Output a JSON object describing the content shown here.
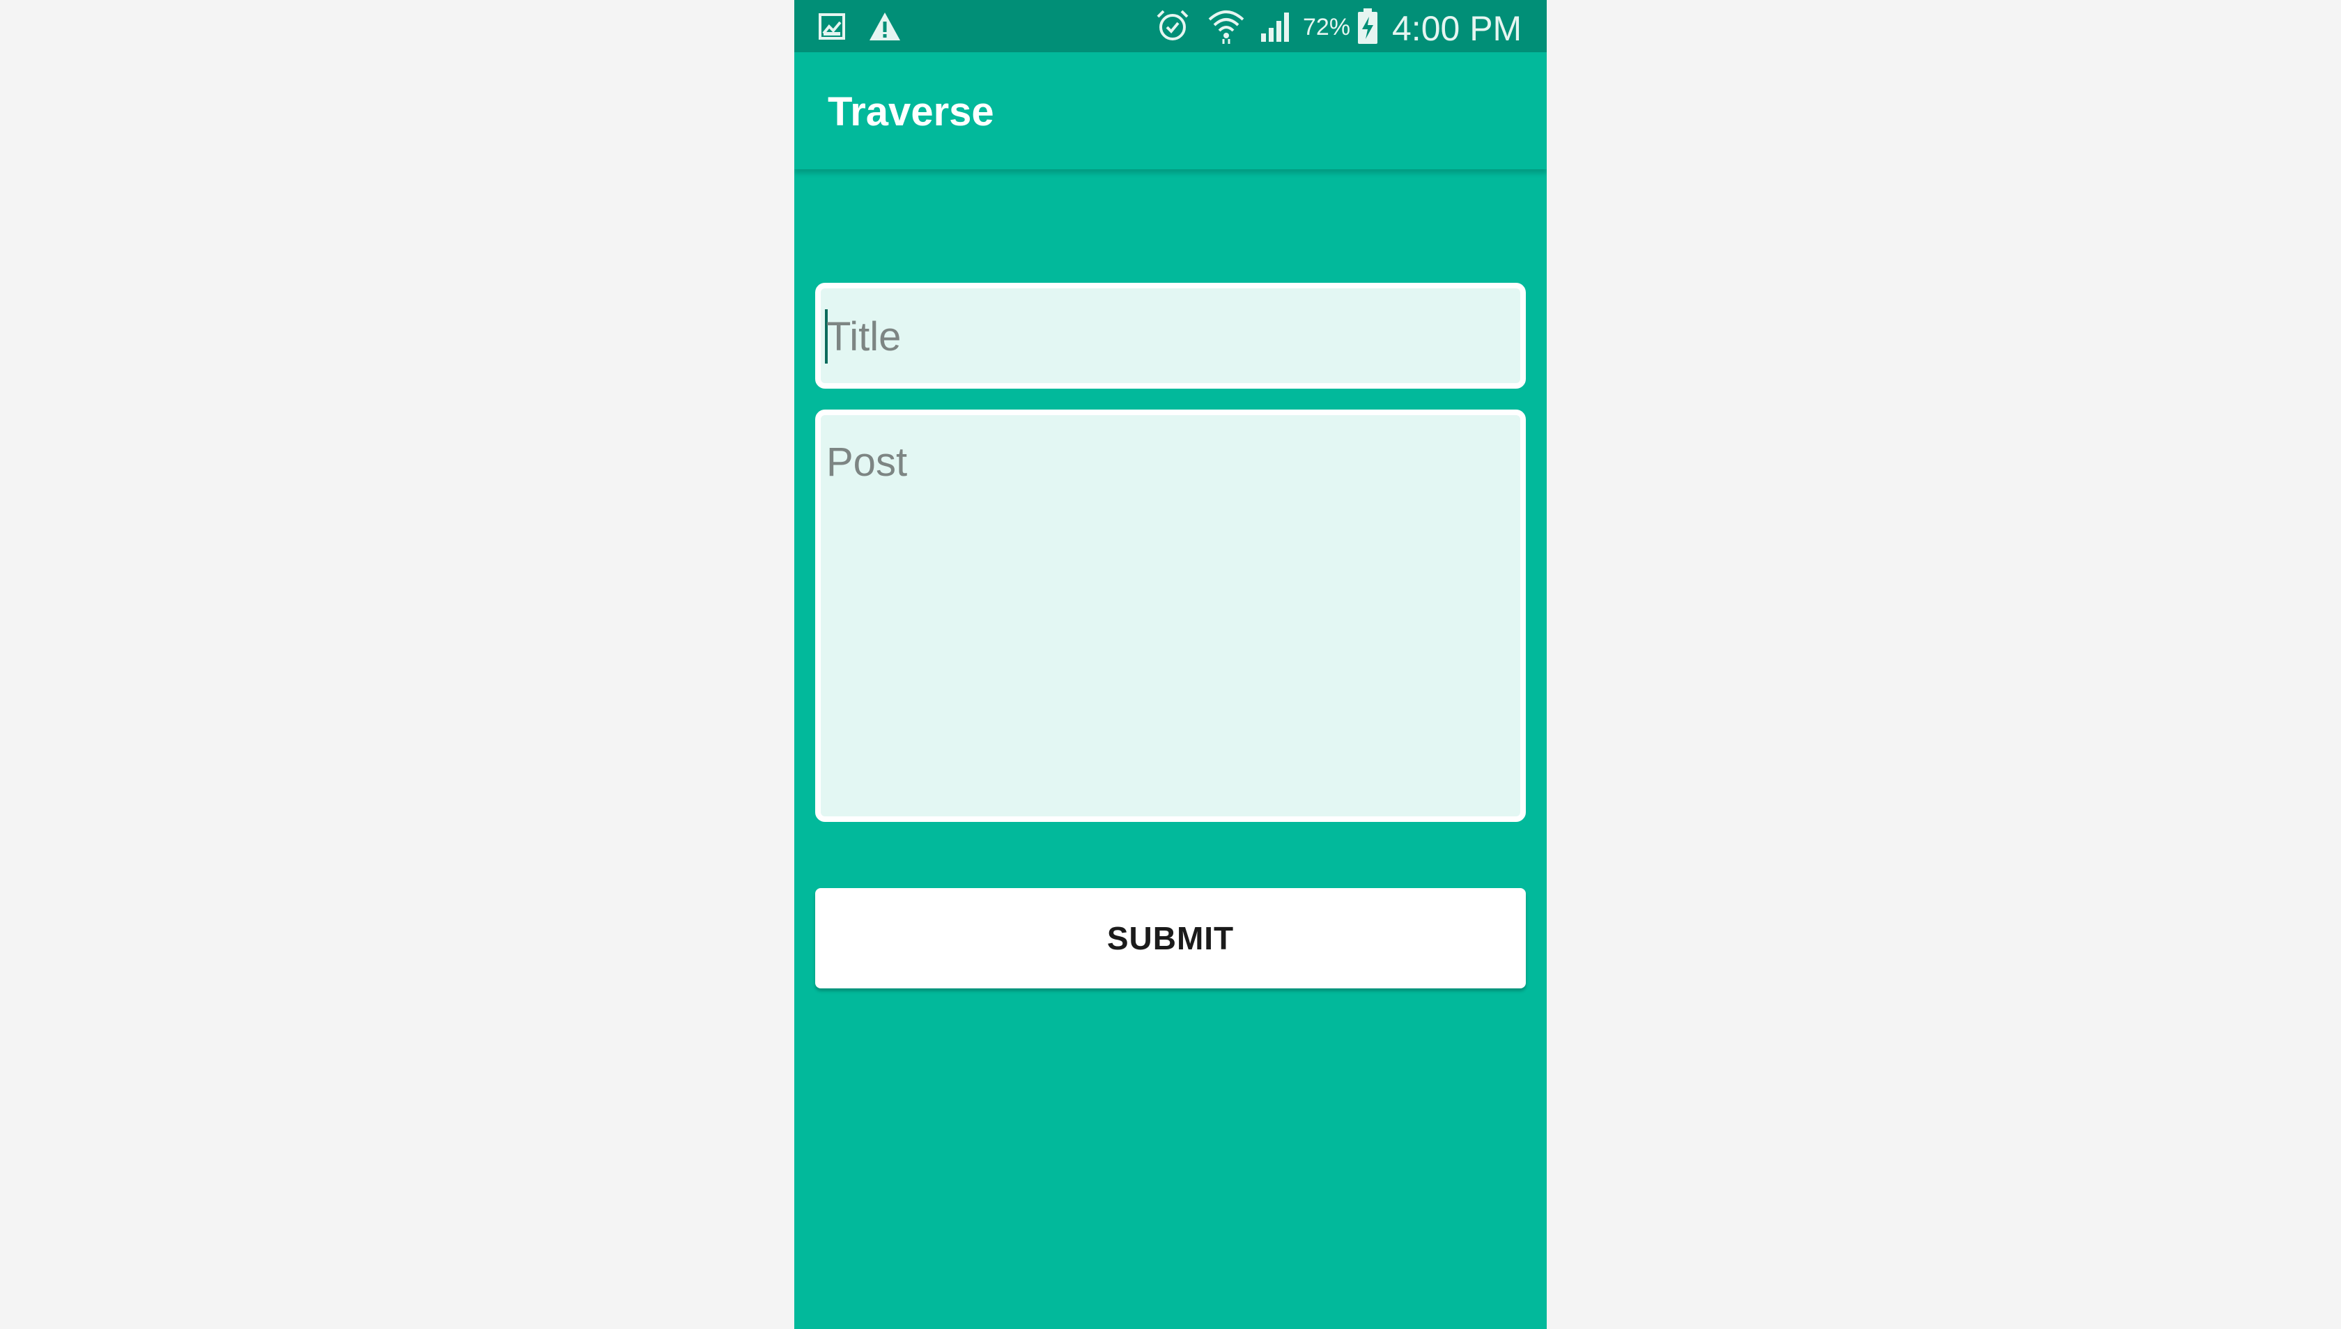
{
  "status_bar": {
    "left_icons": [
      "image-icon",
      "warning-icon"
    ],
    "right_icons": [
      "alarm-icon",
      "wifi-icon",
      "signal-icon",
      "battery-charging-icon"
    ],
    "battery_percent": "72%",
    "time": "4:00 PM"
  },
  "app_bar": {
    "title": "Traverse"
  },
  "form": {
    "title_placeholder": "Title",
    "post_placeholder": "Post",
    "submit_label": "SUBMIT"
  },
  "colors": {
    "status_bar": "#018f77",
    "primary": "#02b99b",
    "field_background": "#e3f7f3",
    "button_background": "#ffffff",
    "page_background": "#f4f4f4"
  }
}
